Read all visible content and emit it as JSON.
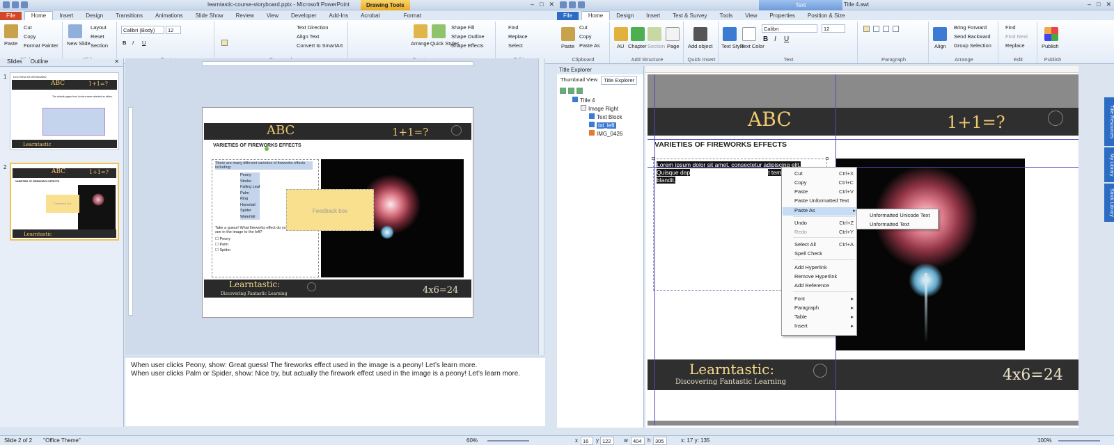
{
  "ppt": {
    "title": "learntastic-course-storyboard.pptx - Microsoft PowerPoint",
    "context_tab": "Drawing Tools",
    "tabs": [
      "File",
      "Home",
      "Insert",
      "Design",
      "Transitions",
      "Animations",
      "Slide Show",
      "Review",
      "View",
      "Developer",
      "Add-Ins",
      "Acrobat",
      "Format"
    ],
    "clipboard": {
      "paste": "Paste",
      "cut": "Cut",
      "copy": "Copy",
      "format_painter": "Format Painter",
      "label": "Clipboard"
    },
    "slides_grp": {
      "new_slide": "New Slide",
      "layout": "Layout",
      "reset": "Reset",
      "section": "Section",
      "label": "Slides"
    },
    "font": {
      "name": "Calibri (Body)",
      "size": "12",
      "label": "Font"
    },
    "paragraph": {
      "text_direction": "Text Direction",
      "align_text": "Align Text",
      "smartart": "Convert to SmartArt",
      "label": "Paragraph"
    },
    "drawing": {
      "arrange": "Arrange",
      "quick_styles": "Quick Styles",
      "shape_fill": "Shape Fill",
      "shape_outline": "Shape Outline",
      "shape_effects": "Shape Effects",
      "label": "Drawing"
    },
    "editing": {
      "find": "Find",
      "replace": "Replace",
      "select": "Select",
      "label": "Editing"
    },
    "pane_tabs": {
      "slides": "Slides",
      "outline": "Outline"
    },
    "thumb1": {
      "num": "1",
      "title": "LECTORA STORYBOARD",
      "abc": "ABC",
      "eq": "1+1=?",
      "foot": "Learntastic",
      "text": "The default pages from Lectora were selected as slides."
    },
    "thumb2": {
      "num": "2",
      "abc": "ABC",
      "eq": "1+1=?",
      "foot": "Learntastic",
      "heading": "VARIETIES OF FIREWORKS EFFECTS",
      "feedback": "Feedback box"
    },
    "slide": {
      "abc": "ABC",
      "eq": "1+1=?",
      "heading": "VARIETIES OF FIREWORKS EFFECTS",
      "intro": "There are many different varieties of fireworks effects including:",
      "bullets": [
        "Peony",
        "Strobe",
        "Falling Leaf",
        "Palm",
        "Ring",
        "Horsetail",
        "Spider",
        "Waterfall"
      ],
      "question": "Take a guess! What fireworks effect do you see in the image to the left?",
      "options": [
        "Peony",
        "Palm",
        "Spider"
      ],
      "feedback": "Feedback box",
      "footer_title": "Learntastic:",
      "footer_sub": "Discovering Fantastic Learning",
      "footer_eq": "4x6=24"
    },
    "notes": [
      "When user clicks Peony, show: Great guess!  The fireworks effect used in the image is a peony! Let’s learn more.",
      "When user clicks Palm or Spider, show: Nice try, but actually the firework effect used in the image is a peony!  Let’s learn more."
    ],
    "status": {
      "slide": "Slide 2 of 2",
      "theme": "\"Office Theme\"",
      "zoom": "60%"
    }
  },
  "lectora": {
    "title": "Lectora Inspire - Title 4.awt",
    "context_tab": "Text",
    "tabs": [
      "File",
      "Home",
      "Design",
      "Insert",
      "Test & Survey",
      "Tools",
      "View",
      "Properties",
      "Position & Size"
    ],
    "clipboard": {
      "paste": "Paste",
      "cut": "Cut",
      "copy": "Copy",
      "paste_as": "Paste As",
      "label": "Clipboard"
    },
    "structure": {
      "au": "AU",
      "chapter": "Chapter",
      "section": "Section",
      "page": "Page",
      "label": "Add Structure"
    },
    "quick": {
      "add_object": "Add object",
      "label": "Quick Insert"
    },
    "text": {
      "style": "Text Style",
      "color": "Text Color",
      "font": "Calibri",
      "size": "12",
      "label": "Text"
    },
    "paragraph_label": "Paragraph",
    "arrange": {
      "align": "Align",
      "forward": "Bring Forward",
      "backward": "Send Backward",
      "group": "Group Selection",
      "label": "Arrange"
    },
    "edit": {
      "find": "Find",
      "find_next": "Find Next",
      "replace": "Replace",
      "label": "Edit"
    },
    "publish": {
      "publish": "Publish",
      "label": "Publish"
    },
    "explorer": {
      "header": "Title Explorer",
      "tab_thumb": "Thumbnail View",
      "tab_title": "Title Explorer",
      "items": [
        "Title 4",
        "Image Right",
        "Text Block",
        "txt_left",
        "IMG_0426"
      ]
    },
    "page": {
      "abc": "ABC",
      "eq": "1+1=?",
      "heading": "VARIETIES OF FIREWORKS EFFECTS",
      "text_line1": "Lorem ipsum dolor sit amet, consectetur adipiscing elit.",
      "text_line2a": "Quisque dap",
      "text_line2b": "t tempus ipsum",
      "text_line3": "blandit.",
      "footer_title": "Learntastic:",
      "footer_sub": "Discovering Fantastic Learning",
      "footer_eq": "4x6=24"
    },
    "menu": [
      {
        "label": "Cut",
        "sc": "Ctrl+X"
      },
      {
        "label": "Copy",
        "sc": "Ctrl+C"
      },
      {
        "label": "Paste",
        "sc": "Ctrl+V"
      },
      {
        "label": "Paste Unformatted Text",
        "sc": ""
      },
      {
        "label": "Paste As",
        "sc": "▸"
      },
      {
        "label": "Undo",
        "sc": "Ctrl+Z"
      },
      {
        "label": "Redo",
        "sc": "Ctrl+Y"
      },
      {
        "label": "Select All",
        "sc": "Ctrl+A"
      },
      {
        "label": "Spell Check",
        "sc": ""
      },
      {
        "label": "Add Hyperlink",
        "sc": ""
      },
      {
        "label": "Remove Hyperlink",
        "sc": ""
      },
      {
        "label": "Add Reference",
        "sc": ""
      },
      {
        "label": "Font",
        "sc": "▸"
      },
      {
        "label": "Paragraph",
        "sc": "▸"
      },
      {
        "label": "Table",
        "sc": "▸"
      },
      {
        "label": "Insert",
        "sc": "▸"
      }
    ],
    "submenu": [
      "Unformatted Unicode Text",
      "Unformatted Text"
    ],
    "side_tabs": [
      "Title Resources",
      "My Library",
      "Stock Library"
    ],
    "status": {
      "x": "16",
      "y": "122",
      "w": "404",
      "h": "305",
      "cursor": "x: 17 y: 135",
      "zoom": "100%"
    }
  },
  "colors": {
    "ppt_file": "#d24726",
    "lectora_file": "#2b6cc4",
    "chalk": "#f0c870",
    "feedback": "#f9e08e"
  }
}
